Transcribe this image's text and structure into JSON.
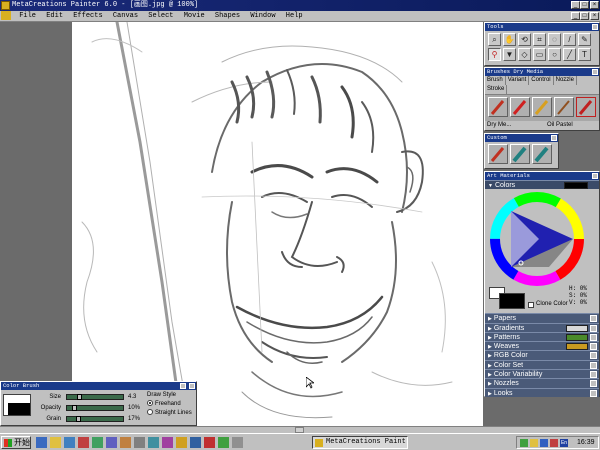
{
  "app": {
    "title": "MetaCreations Painter 6.0 - [画图.jpg @ 100%]"
  },
  "menu": [
    "File",
    "Edit",
    "Effects",
    "Canvas",
    "Select",
    "Movie",
    "Shapes",
    "Window",
    "Help"
  ],
  "tools_palette": {
    "title": "Tools",
    "tools": [
      "magnifier-icon",
      "grabber-icon",
      "rotate-icon",
      "crop-icon",
      "lasso-icon",
      "brush-icon",
      "pen-icon",
      "dropper-icon",
      "bucket-icon",
      "eraser-icon",
      "rect-select-icon",
      "oval-icon",
      "line-icon",
      "text-icon"
    ]
  },
  "brushes_palette": {
    "title": "Brushes Dry Media",
    "tabs": [
      "Brush",
      "Variant",
      "Control",
      "Nozzle",
      "Stroke"
    ],
    "current_brush": "Dry Me...",
    "current_variant": "Oil Pastel"
  },
  "custom_palette": {
    "title": "Custom"
  },
  "art_materials": {
    "title": "Art Materials",
    "colors_label": "Colors",
    "clone_color_label": "Clone Color",
    "hsv": {
      "h": "H: 0%",
      "s": "S: 0%",
      "v": "V: 0%"
    },
    "sections": [
      {
        "label": "Papers",
        "swatch": ""
      },
      {
        "label": "Gradients",
        "swatch": "#d8d8d8"
      },
      {
        "label": "Patterns",
        "swatch": "#4a8a2a"
      },
      {
        "label": "Weaves",
        "swatch": "#c89a20"
      },
      {
        "label": "RGB Color",
        "swatch": ""
      },
      {
        "label": "Color Set",
        "swatch": ""
      },
      {
        "label": "Color Variability",
        "swatch": ""
      },
      {
        "label": "Nozzles",
        "swatch": ""
      },
      {
        "label": "Looks",
        "swatch": ""
      }
    ]
  },
  "color_brush": {
    "title": "Color Brush",
    "size_label": "Size",
    "size_value": "4.3",
    "size_fraction": 0.2,
    "opacity_label": "Opacity",
    "opacity_value": "10%",
    "opacity_fraction": 0.1,
    "grain_label": "Grain",
    "grain_value": "17%",
    "grain_fraction": 0.17,
    "draw_style_label": "Draw Style",
    "freehand_label": "Freehand",
    "straight_label": "Straight Lines"
  },
  "taskbar": {
    "start_label": "开始",
    "task_label": "MetaCreations Paint...",
    "clock": "16:39"
  }
}
